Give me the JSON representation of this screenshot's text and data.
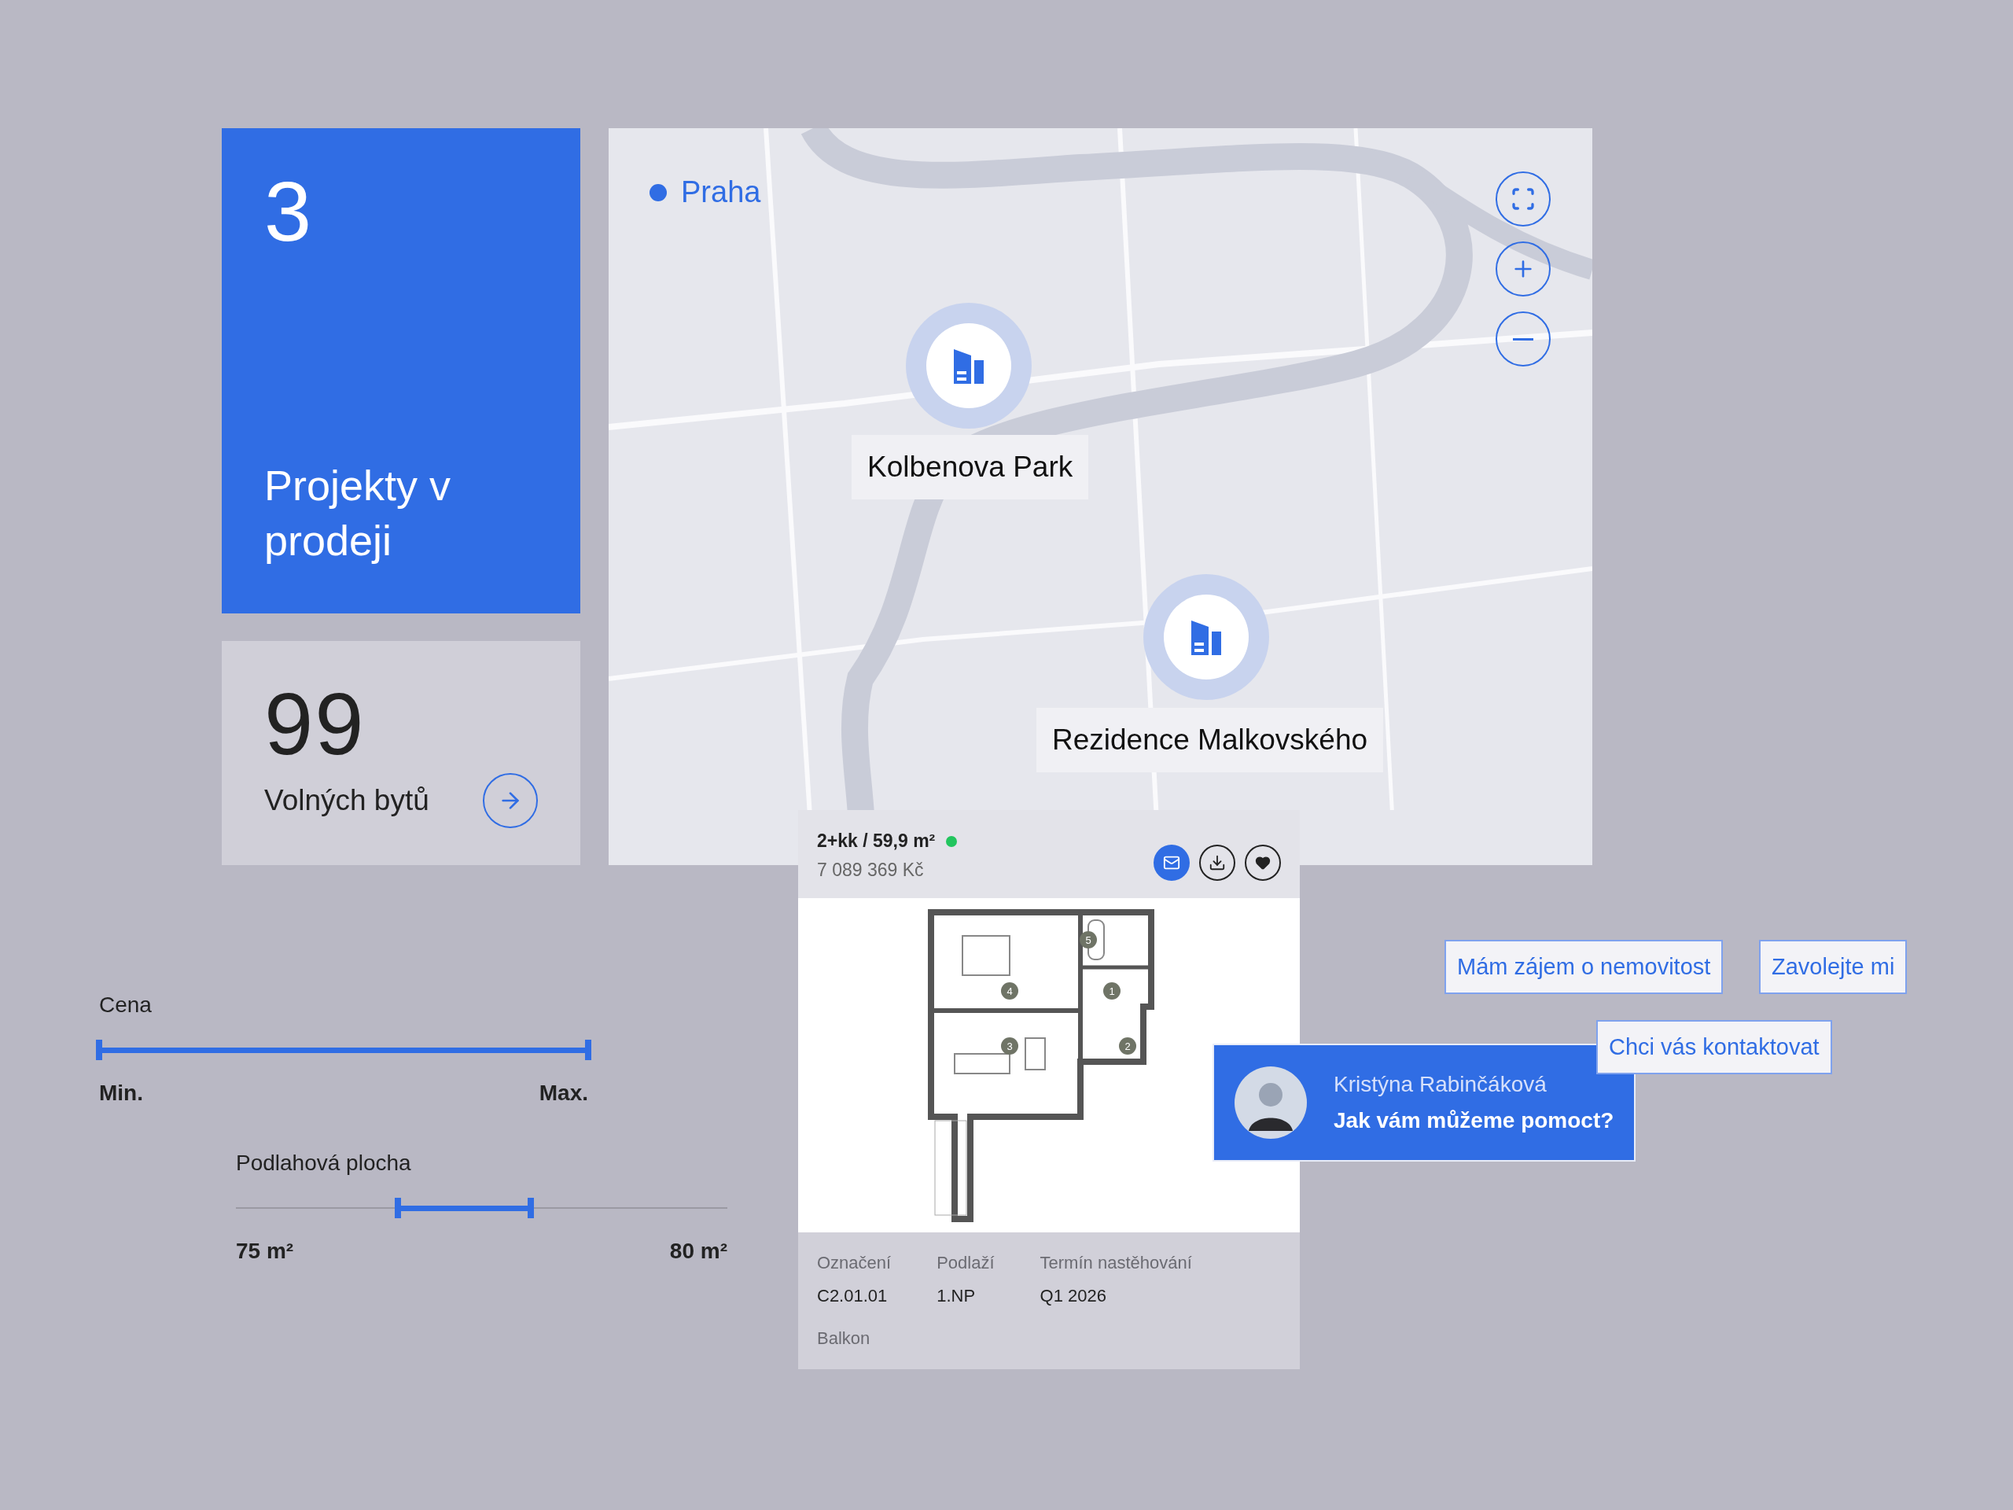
{
  "projects_card": {
    "count": "3",
    "label": "Projekty v prodeji"
  },
  "units_card": {
    "count": "99",
    "label": "Volných bytů"
  },
  "map": {
    "city": "Praha",
    "pins": [
      {
        "name": "Kolbenova Park"
      },
      {
        "name": "Rezidence Malkovského"
      }
    ]
  },
  "sliders": [
    {
      "label": "Cena",
      "min_label": "Min.",
      "max_label": "Max.",
      "thumbs": [
        {
          "level": 0
        },
        {
          "level": 1
        }
      ]
    },
    {
      "label": "Podlahová plocha",
      "min_label": "75 m²",
      "max_label": "80 m²",
      "thumbs": [
        {
          "level": 0.33
        },
        {
          "level": 0.6
        }
      ]
    }
  ],
  "listing": {
    "title": "2+kk / 59,9 m²",
    "available": true,
    "price": "7 089 369 Kč",
    "room_numbers": [
      "4",
      "1",
      "3",
      "2",
      "5"
    ],
    "details": [
      {
        "label": "Označení",
        "value": "C2.01.01"
      },
      {
        "label": "Podlaží",
        "value": "1.NP"
      },
      {
        "label": "Termín nastěhování",
        "value": "Q1 2026"
      }
    ],
    "extra": "Balkon"
  },
  "actions": [
    "Mám zájem o nemovitost",
    "Zavolejte mi",
    "Chci vás kontaktovat"
  ],
  "contact": {
    "name": "Kristýna Rabinčáková",
    "message": "Jak vám můžeme pomoct?"
  }
}
